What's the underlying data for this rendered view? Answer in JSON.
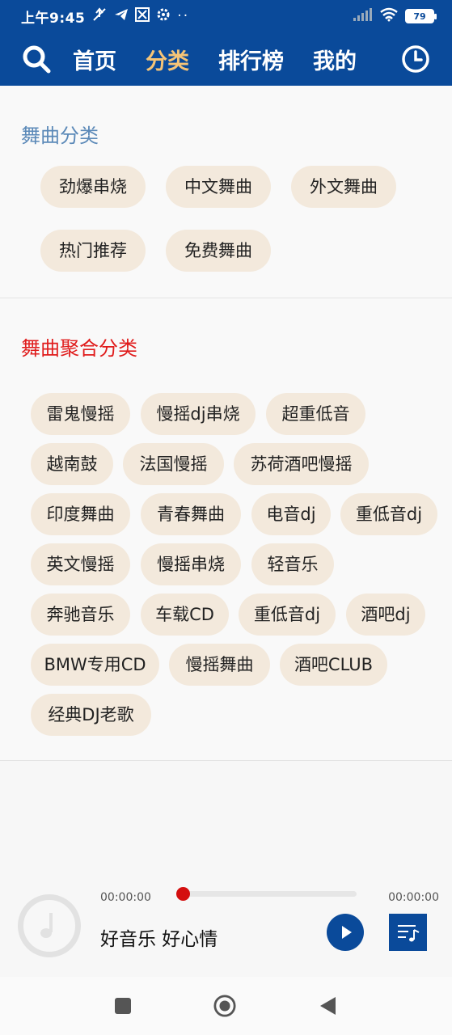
{
  "status_bar": {
    "time": "上午9:45",
    "battery": "79"
  },
  "nav": {
    "tabs": [
      {
        "label": "首页"
      },
      {
        "label": "分类"
      },
      {
        "label": "排行榜"
      },
      {
        "label": "我的"
      }
    ],
    "active_tab": "分类"
  },
  "section1": {
    "title": "舞曲分类",
    "chips": [
      "劲爆串烧",
      "中文舞曲",
      "外文舞曲",
      "热门推荐",
      "免费舞曲"
    ]
  },
  "section2": {
    "title": "舞曲聚合分类",
    "chips": [
      "雷鬼慢摇",
      "慢摇dj串烧",
      "超重低音",
      "越南鼓",
      "法国慢摇",
      "苏荷酒吧慢摇",
      "印度舞曲",
      "青春舞曲",
      "电音dj",
      "重低音dj",
      "英文慢摇",
      "慢摇串烧",
      "轻音乐",
      "奔驰音乐",
      "车载CD",
      "重低音dj",
      "酒吧dj",
      "BMW专用CD",
      "慢摇舞曲",
      "酒吧CLUB",
      "经典DJ老歌"
    ]
  },
  "player": {
    "current_time": "00:00:00",
    "total_time": "00:00:00",
    "title": "好音乐 好心情",
    "progress": 0
  },
  "colors": {
    "header_bg": "#0a4a9a",
    "active_tab": "#f5c477",
    "section1_title": "#5b89b8",
    "section2_title": "#e01c1c",
    "chip_bg": "#f3e9dc",
    "progress_knob": "#d40f0f"
  },
  "icons": {
    "search": "search-icon",
    "history": "clock-icon",
    "play": "play-icon",
    "playlist": "playlist-icon",
    "disc": "music-note-icon"
  }
}
